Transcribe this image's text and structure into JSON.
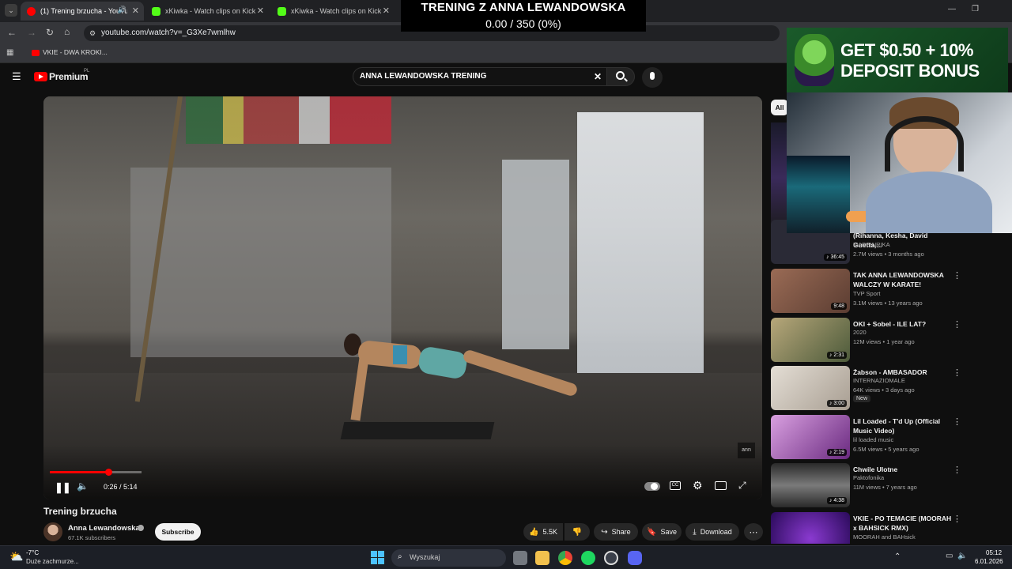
{
  "browser": {
    "tabs": [
      {
        "title": "(1) Trening brzucha - YouTube",
        "color": "#ff0000"
      },
      {
        "title": "xKiwka - Watch clips on Kick",
        "color": "#53fc18"
      },
      {
        "title": "xKiwka - Watch clips on Kick",
        "color": "#53fc18"
      }
    ],
    "new_tab": "+",
    "url": "youtube.com/watch?v=_G3Xe7wmlhw",
    "bookmark": "VKIE - DWA KROKI..."
  },
  "overlay": {
    "title": "TRENING Z ANNA LEWANDOWSKA",
    "progress": "0.00 / 350 (0%)"
  },
  "ad": {
    "line1": "GET $0.50 + 10%",
    "line2": "DEPOSIT BONUS"
  },
  "youtube": {
    "logo": "Premium",
    "logo_region": "PL",
    "search_value": "ANNA LEWANDOWSKA TRENING",
    "filter_chip": "All",
    "player": {
      "time": "0:26 / 5:14",
      "progress_fraction": 0.083,
      "watermark": "ann"
    },
    "video_title": "Trening brzucha",
    "channel": {
      "name": "Anna Lewandowska",
      "subscribers": "67.1K subscribers",
      "subscribe": "Subscribe"
    },
    "actions": {
      "likes": "5.5K",
      "share": "Share",
      "save": "Save",
      "download": "Download"
    },
    "recommended": [
      {
        "title": "(Rihanna, Kesha, David Guetta,...",
        "channel": "MADEINRIKA",
        "meta": "2.7M views • 3 months ago",
        "duration": "36:45",
        "thumb": "#2a2a36"
      },
      {
        "title": "TAK ANNA LEWANDOWSKA WALCZY W KARATE!",
        "channel": "TVP Sport",
        "meta": "3.1M views • 13 years ago",
        "duration": "9:48",
        "thumb": "#7b5a4a"
      },
      {
        "title": "OKI + Sobel - ILE LAT?",
        "channel": "2020",
        "meta": "12M views • 1 year ago",
        "duration": "2:31",
        "thumb": "#8a7a5a"
      },
      {
        "title": "Żabson - AMBASADOR",
        "channel": "INTERNAZIOMALE",
        "meta": "64K views • 3 days ago",
        "badge": "New",
        "duration": "3:00",
        "thumb": "#c9c2b8"
      },
      {
        "title": "Lil Loaded - T'd Up (Official Music Video)",
        "channel": "lil loaded music",
        "meta": "6.5M views • 5 years ago",
        "duration": "2:19",
        "thumb": "#b05ac0"
      },
      {
        "title": "Chwile Ulotne",
        "channel": "Paktofonika",
        "meta": "11M views • 7 years ago",
        "duration": "4:38",
        "thumb": "#5a5a5a"
      },
      {
        "title": "VKIE - PO TEMACIE (MOORAH x BAHSICK RMX)",
        "channel": "MOORAH",
        "channel_extra": "and BAHsick",
        "duration": "",
        "thumb": "#4a1a8a"
      }
    ]
  },
  "taskbar": {
    "weather_temp": "-7°C",
    "weather_desc": "Duże zachmurze...",
    "search": "Wyszukaj",
    "time": "05:12",
    "date": "6.01.2026"
  }
}
